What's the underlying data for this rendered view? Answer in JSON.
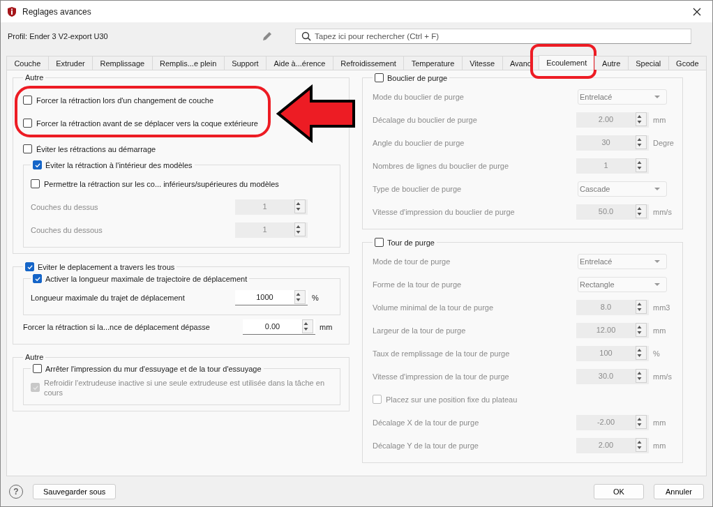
{
  "window": {
    "title": "Reglages avances"
  },
  "profile": {
    "label": "Profil: Ender 3 V2-export U30"
  },
  "search": {
    "placeholder": "Tapez ici pour rechercher (Ctrl + F)"
  },
  "tabs": [
    {
      "label": "Couche",
      "selected": false,
      "highlighted": false
    },
    {
      "label": "Extruder",
      "selected": false,
      "highlighted": false
    },
    {
      "label": "Remplissage",
      "selected": false,
      "highlighted": false
    },
    {
      "label": "Remplis...e plein",
      "selected": false,
      "highlighted": false
    },
    {
      "label": "Support",
      "selected": false,
      "highlighted": false
    },
    {
      "label": "Aide à...érence",
      "selected": false,
      "highlighted": false
    },
    {
      "label": "Refroidissement",
      "selected": false,
      "highlighted": false
    },
    {
      "label": "Temperature",
      "selected": false,
      "highlighted": false
    },
    {
      "label": "Vitesse",
      "selected": false,
      "highlighted": false
    },
    {
      "label": "Avanc",
      "selected": false,
      "highlighted": false
    },
    {
      "label": "Ecoulement",
      "selected": true,
      "highlighted": true
    },
    {
      "label": "Autre",
      "selected": false,
      "highlighted": false
    },
    {
      "label": "Special",
      "selected": false,
      "highlighted": false
    },
    {
      "label": "Gcode",
      "selected": false,
      "highlighted": false
    }
  ],
  "left": [
    {
      "kind": "group",
      "title": "Autre",
      "items": [
        {
          "kind": "highlight",
          "arrow": true,
          "items": [
            {
              "kind": "checkbox",
              "label": "Forcer la rétraction lors d'un changement de couche",
              "checked": false,
              "disabled": false
            },
            {
              "kind": "checkbox",
              "label": "Forcer la rétraction avant de se déplacer vers la coque extérieure",
              "checked": false,
              "disabled": false
            }
          ]
        },
        {
          "kind": "checkbox",
          "label": "Éviter les rétractions au démarrage",
          "checked": false,
          "disabled": false
        },
        {
          "kind": "group",
          "title": "Éviter la rétraction à l'intérieur des modèles",
          "checked": true,
          "items": [
            {
              "kind": "checkbox",
              "label": "Permettre la rétraction sur les co... inférieurs/supérieures du modèles",
              "checked": false,
              "disabled": false
            },
            {
              "kind": "spin",
              "label": "Couches du dessus",
              "value": "1",
              "disabled": true
            },
            {
              "kind": "spin",
              "label": "Couches du dessous",
              "value": "1",
              "disabled": true
            }
          ]
        }
      ]
    },
    {
      "kind": "group",
      "title": "Eviter le deplacement a travers les trous",
      "checked": true,
      "items": [
        {
          "kind": "group",
          "title": "Activer la longueur maximale de trajectoire de déplacement",
          "checked": true,
          "items": [
            {
              "kind": "spin",
              "label": "Longueur maximale du trajet de déplacement",
              "value": "1000",
              "unit": "%",
              "disabled": false
            }
          ]
        },
        {
          "kind": "spin",
          "label": "Forcer la rétraction si la...nce de déplacement dépasse",
          "value": "0.00",
          "unit": "mm",
          "disabled": false
        }
      ]
    },
    {
      "kind": "group",
      "title": "Autre",
      "items": [
        {
          "kind": "group",
          "title": "Arrêter l'impression du mur d'essuyage et de la tour d'essuyage",
          "checked": false,
          "items": [
            {
              "kind": "checkbox",
              "label": "Refroidir l'extrudeuse inactive si une seule extrudeuse est utilisée dans la tâche en cours",
              "checked": true,
              "disabled": true
            }
          ]
        }
      ]
    }
  ],
  "right": [
    {
      "kind": "group",
      "title": "Bouclier de purge",
      "checked": false,
      "items": [
        {
          "kind": "select",
          "label": "Mode du bouclier de purge",
          "value": "Entrelacé",
          "disabled": true
        },
        {
          "kind": "spin",
          "label": "Décalage du bouclier de purge",
          "value": "2.00",
          "unit": "mm",
          "disabled": true
        },
        {
          "kind": "spin",
          "label": "Angle du bouclier de purge",
          "value": "30",
          "unit": "Degre",
          "disabled": true
        },
        {
          "kind": "spin",
          "label": "Nombres de lignes du bouclier de purge",
          "value": "1",
          "disabled": true
        },
        {
          "kind": "select",
          "label": "Type de bouclier de purge",
          "value": "Cascade",
          "disabled": true
        },
        {
          "kind": "spin",
          "label": "Vitesse d'impression du bouclier de purge",
          "value": "50.0",
          "unit": "mm/s",
          "disabled": true
        }
      ]
    },
    {
      "kind": "group",
      "title": "Tour de purge",
      "checked": false,
      "items": [
        {
          "kind": "select",
          "label": "Mode de tour de purge",
          "value": "Entrelacé",
          "disabled": true
        },
        {
          "kind": "select",
          "label": "Forme de la tour de purge",
          "value": "Rectangle",
          "disabled": true
        },
        {
          "kind": "spin",
          "label": "Volume minimal de la tour de purge",
          "value": "8.0",
          "unit": "mm3",
          "disabled": true
        },
        {
          "kind": "spin",
          "label": "Largeur de la tour de purge",
          "value": "12.00",
          "unit": "mm",
          "disabled": true
        },
        {
          "kind": "spin",
          "label": "Taux de remplissage de la tour de purge",
          "value": "100",
          "unit": "%",
          "disabled": true
        },
        {
          "kind": "spin",
          "label": "Vitesse d'impression de la tour de purge",
          "value": "30.0",
          "unit": "mm/s",
          "disabled": true
        },
        {
          "kind": "checkbox",
          "label": "Placez sur une position fixe du plateau",
          "checked": false,
          "disabled": true
        },
        {
          "kind": "spin",
          "label": "Décalage X de la tour de purge",
          "value": "-2.00",
          "unit": "mm",
          "disabled": true
        },
        {
          "kind": "spin",
          "label": "Décalage Y de la tour de purge",
          "value": "2.00",
          "unit": "mm",
          "disabled": true
        }
      ]
    }
  ],
  "footer": {
    "help": "?",
    "save_as": "Sauvegarder sous",
    "ok": "OK",
    "cancel": "Annuler"
  }
}
